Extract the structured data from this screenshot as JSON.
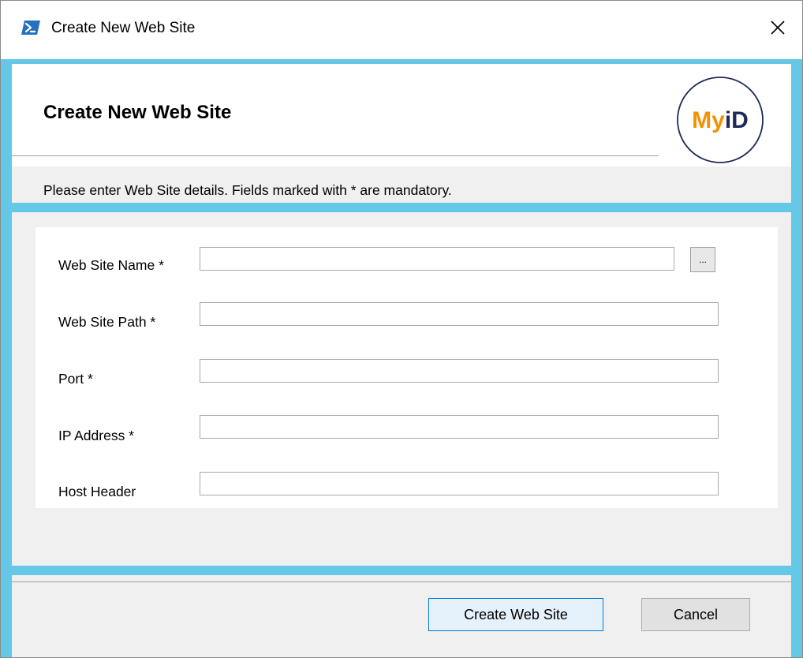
{
  "window": {
    "title": "Create New Web Site",
    "close_symbol": "✕",
    "icon": "powershell-icon"
  },
  "header": {
    "title": "Create New Web Site",
    "logo_text_my": "My",
    "logo_text_id": "iD",
    "instructions": "Please enter Web Site details. Fields marked with * are mandatory."
  },
  "form": {
    "fields": [
      {
        "label": "Web Site Name *",
        "value": "",
        "placeholder": ""
      },
      {
        "label": "Web Site Path *",
        "value": "",
        "placeholder": ""
      },
      {
        "label": "Port *",
        "value": "",
        "placeholder": ""
      },
      {
        "label": "IP Address *",
        "value": "",
        "placeholder": ""
      },
      {
        "label": "Host Header",
        "value": "",
        "placeholder": ""
      }
    ],
    "browse_label": "..."
  },
  "footer": {
    "create_label": "Create Web Site",
    "cancel_label": "Cancel"
  },
  "colors": {
    "frame": "#64c8e6",
    "logo_orange": "#f39200",
    "logo_navy": "#1f2a5a",
    "primary_border": "#0078d7",
    "powershell_blue": "#2671be"
  }
}
